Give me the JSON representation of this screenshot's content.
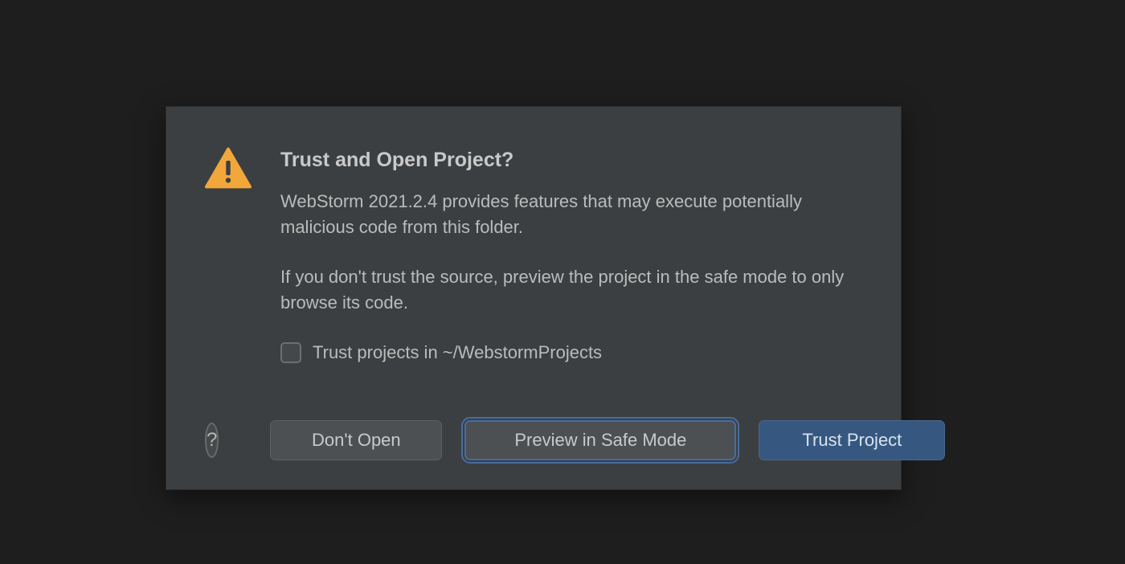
{
  "dialog": {
    "title": "Trust and Open Project?",
    "paragraph1": "WebStorm 2021.2.4 provides features that may execute potentially malicious code from this folder.",
    "paragraph2": "If you don't trust the source, preview the project in the safe mode to only browse its code.",
    "trust_checkbox_label": "Trust projects in ~/WebstormProjects",
    "help_label": "?",
    "buttons": {
      "dont_open": "Don't Open",
      "preview_safe": "Preview in Safe Mode",
      "trust_project": "Trust Project"
    }
  }
}
